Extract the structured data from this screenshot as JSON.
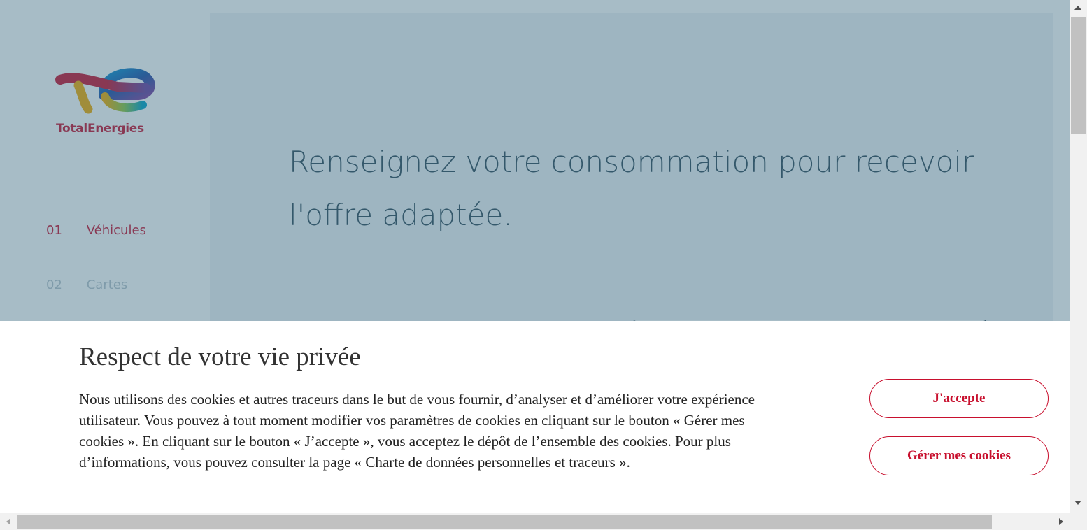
{
  "brand": {
    "name": "TotalEnergies",
    "color": "#c8102e"
  },
  "steps": [
    {
      "number": "01",
      "label": "Véhicules"
    },
    {
      "number": "02",
      "label": "Cartes"
    }
  ],
  "main": {
    "headline": "Renseignez votre consommation pour recevoir l'offre adaptée."
  },
  "cookie_banner": {
    "title": "Respect de votre vie privée",
    "text": "Nous utilisons des cookies et autres traceurs dans le but de vous fournir, d’analyser et d’améliorer votre expérience utilisateur. Vous pouvez à tout moment modifier vos paramètres de cookies en cliquant sur le bouton « Gérer mes cookies ». En cliquant sur le bouton « J’accepte », vous acceptez le dépôt de l’ensemble des cookies. Pour plus d’informations, vous pouvez consulter la page « Charte de données personnelles et traceurs ».",
    "accept_label": "J'accepte",
    "manage_label": "Gérer mes cookies"
  },
  "icons": {
    "scroll_up": "scroll-up-arrow-icon",
    "scroll_down": "scroll-down-arrow-icon",
    "scroll_left": "scroll-left-arrow-icon",
    "scroll_right": "scroll-right-arrow-icon"
  }
}
